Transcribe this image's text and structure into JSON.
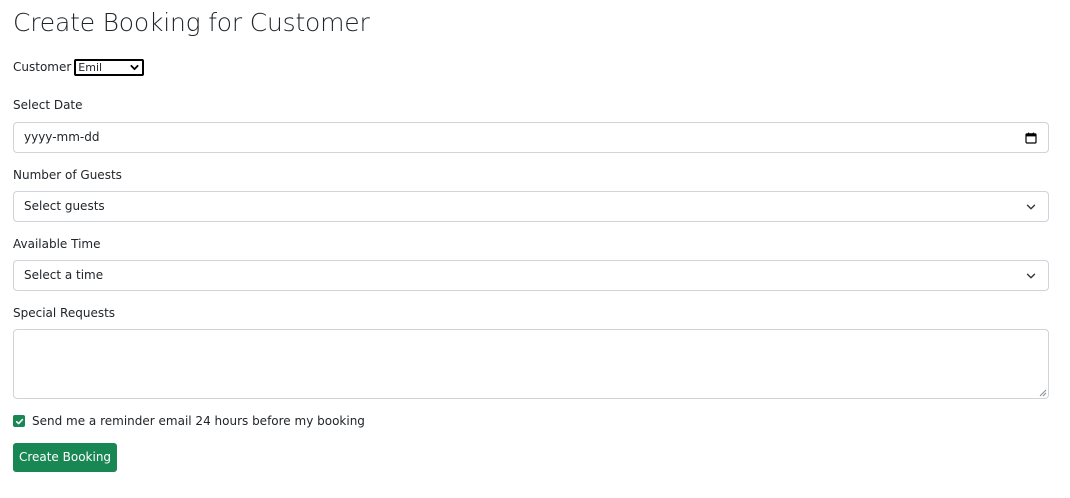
{
  "page": {
    "title": "Create Booking for Customer"
  },
  "customer": {
    "label": "Customer",
    "selected": "Emil"
  },
  "date": {
    "label": "Select Date",
    "placeholder": "yyyy-mm-dd",
    "icon": "calendar-icon"
  },
  "guests": {
    "label": "Number of Guests",
    "selected": "Select guests",
    "icon": "chevron-down-icon"
  },
  "time": {
    "label": "Available Time",
    "selected": "Select a time",
    "icon": "chevron-down-icon"
  },
  "requests": {
    "label": "Special Requests",
    "value": ""
  },
  "reminder": {
    "checked": true,
    "label": "Send me a reminder email 24 hours before my booking"
  },
  "submit": {
    "label": "Create Booking"
  },
  "colors": {
    "primary": "#198754",
    "border": "#ced4da",
    "text": "#212529"
  }
}
